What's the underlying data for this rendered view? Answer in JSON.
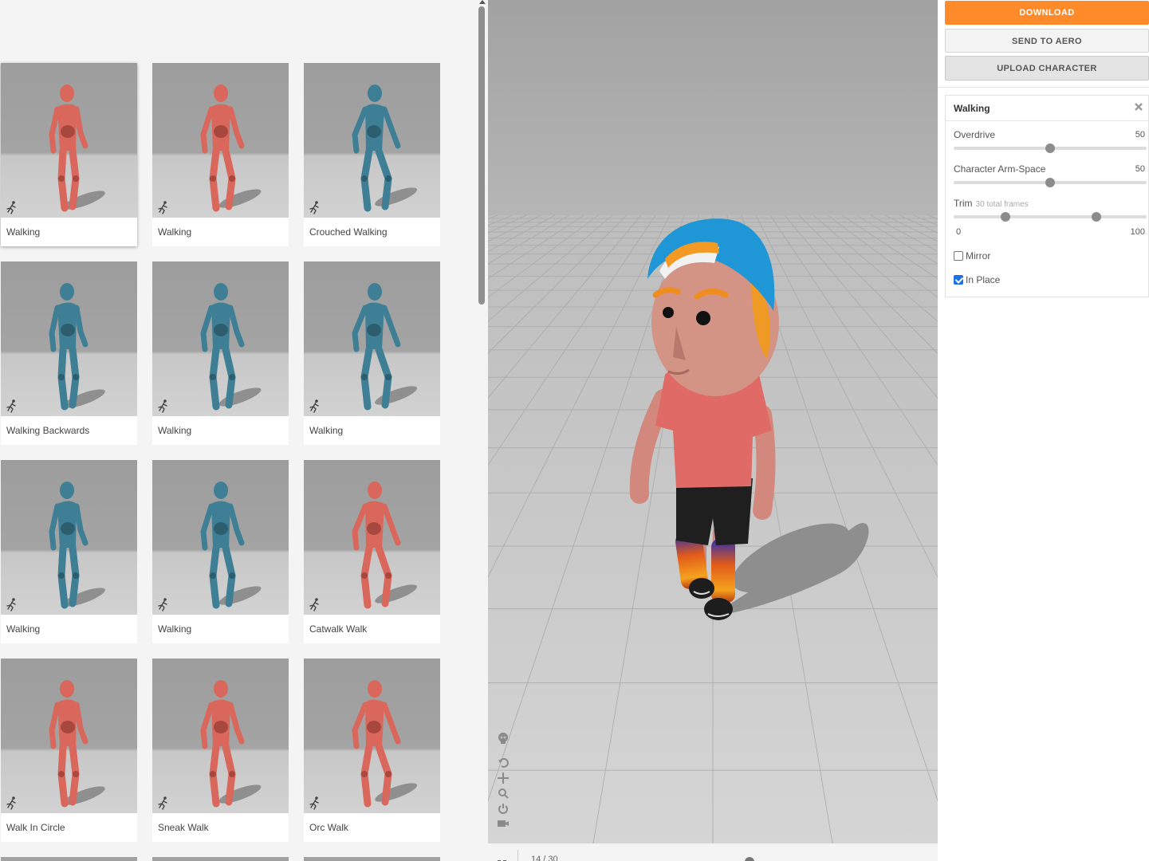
{
  "animations": [
    {
      "label": "Walking",
      "color": "red"
    },
    {
      "label": "Walking",
      "color": "red"
    },
    {
      "label": "Crouched Walking",
      "color": "blue"
    },
    {
      "label": "Walking Backwards",
      "color": "blue"
    },
    {
      "label": "Walking",
      "color": "blue"
    },
    {
      "label": "Walking",
      "color": "blue"
    },
    {
      "label": "Walking",
      "color": "blue"
    },
    {
      "label": "Walking",
      "color": "blue"
    },
    {
      "label": "Catwalk Walk",
      "color": "red"
    },
    {
      "label": "Walk In Circle",
      "color": "red"
    },
    {
      "label": "Sneak Walk",
      "color": "red"
    },
    {
      "label": "Orc Walk",
      "color": "red"
    }
  ],
  "colors": {
    "accent": "#ff8a2a",
    "red_model": "#d9675b",
    "blue_model": "#3f7f95",
    "checkbox": "#1a73e8"
  },
  "actions": {
    "download": "DOWNLOAD",
    "send_to_aero": "SEND TO AERO",
    "upload_character": "UPLOAD CHARACTER"
  },
  "settings": {
    "title": "Walking",
    "overdrive": {
      "label": "Overdrive",
      "value": "50",
      "fraction": 0.5
    },
    "arm_space": {
      "label": "Character Arm-Space",
      "value": "50",
      "fraction": 0.5
    },
    "trim": {
      "label": "Trim",
      "sub": "30 total frames",
      "min": "0",
      "max": "100",
      "start_fraction": 0.27,
      "end_fraction": 0.74
    },
    "mirror": {
      "label": "Mirror",
      "checked": false
    },
    "in_place": {
      "label": "In Place",
      "checked": true
    }
  },
  "timeline": {
    "counter": "14 / 30"
  },
  "icons": [
    "running-figure-icon",
    "skull-icon",
    "undo-icon",
    "move-icon",
    "zoom-icon",
    "power-icon",
    "camera-icon",
    "close-icon",
    "pause-icon"
  ]
}
